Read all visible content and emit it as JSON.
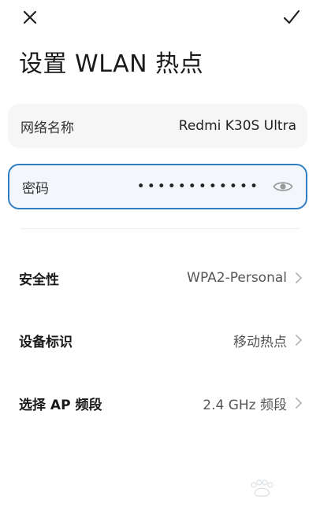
{
  "header": {
    "title": "设置 WLAN 热点"
  },
  "icons": {
    "close": "close-icon",
    "confirm": "check-icon",
    "password_visibility": "eye-icon",
    "chevron": "chevron-right-icon"
  },
  "fields": {
    "network_name": {
      "label": "网络名称",
      "value": "Redmi K30S Ultra"
    },
    "password": {
      "label": "密码",
      "masked_value": "••••••••••••"
    }
  },
  "settings": {
    "security": {
      "label": "安全性",
      "value": "WPA2-Personal"
    },
    "device_id": {
      "label": "设备标识",
      "value": "移动热点"
    },
    "ap_band": {
      "label": "选择 AP 频段",
      "value": "2.4 GHz 频段"
    }
  },
  "colors": {
    "accent": "#2e7fc4",
    "field_background": "#f6f6f6",
    "text_primary": "#1a1a1a",
    "text_secondary": "#555555"
  }
}
